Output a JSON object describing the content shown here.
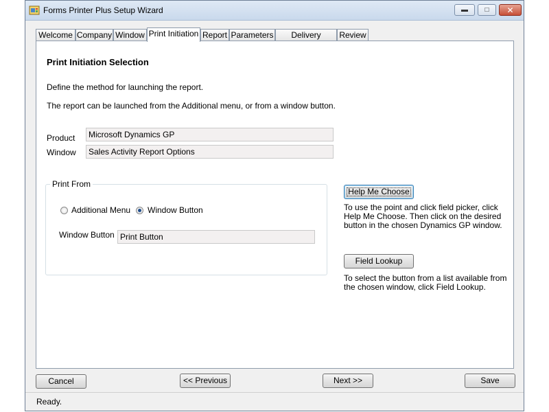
{
  "window": {
    "title": "Forms Printer Plus Setup Wizard",
    "icon": "app-wizard-icon",
    "controls": {
      "minimize": "minimize-icon",
      "maximize": "maximize-icon",
      "close": "close-icon"
    }
  },
  "tabs": [
    {
      "label": "Welcome",
      "active": false
    },
    {
      "label": "Company",
      "active": false
    },
    {
      "label": "Window",
      "active": false
    },
    {
      "label": "Print Initiation",
      "active": true
    },
    {
      "label": "Report",
      "active": false
    },
    {
      "label": "Parameters",
      "active": false
    },
    {
      "label": "Delivery Options",
      "active": false
    },
    {
      "label": "Review",
      "active": false
    }
  ],
  "page": {
    "heading": "Print Initiation Selection",
    "description1": "Define the method for launching the report.",
    "description2": "The report can be launched from the Additional menu, or from a window button.",
    "product_label": "Product",
    "product_value": "Microsoft Dynamics GP",
    "window_label": "Window",
    "window_value": "Sales Activity Report Options"
  },
  "print_from": {
    "legend": "Print From",
    "options": [
      {
        "label": "Additional Menu",
        "selected": false
      },
      {
        "label": "Window Button",
        "selected": true
      }
    ],
    "window_button_label": "Window Button",
    "window_button_value": "Print Button"
  },
  "help": {
    "help_me_choose_label": "Help Me Choose",
    "help_me_choose_text": [
      "To use the point and click field picker, click",
      "Help Me Choose. Then click on the desired",
      "button in the chosen Dynamics GP window."
    ],
    "field_lookup_label": "Field Lookup",
    "field_lookup_text": [
      "To select the button from a list available from",
      "the chosen window, click Field Lookup."
    ]
  },
  "footer": {
    "cancel": "Cancel",
    "previous": "<< Previous",
    "next": "Next >>",
    "save": "Save"
  },
  "status": {
    "text": "Ready."
  }
}
